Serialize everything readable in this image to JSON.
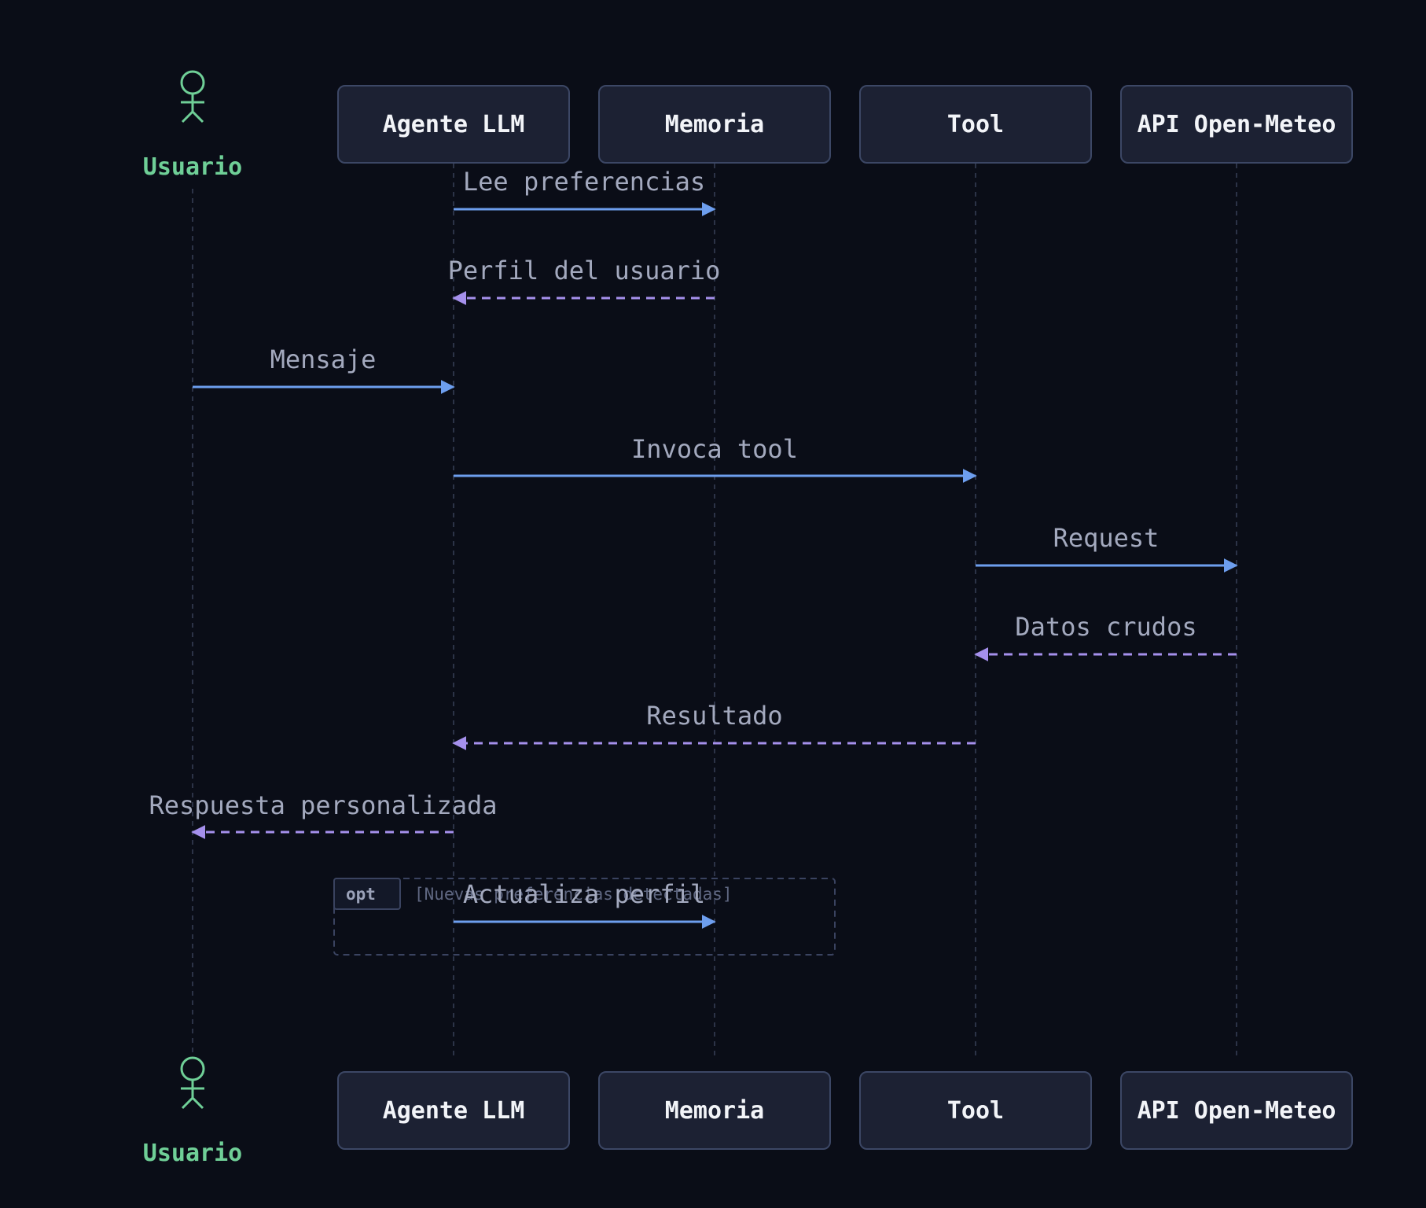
{
  "diagram": {
    "actor": {
      "id": "usuario",
      "label": "Usuario"
    },
    "participants": [
      {
        "id": "agente",
        "label": "Agente LLM"
      },
      {
        "id": "memoria",
        "label": "Memoria"
      },
      {
        "id": "tool",
        "label": "Tool"
      },
      {
        "id": "api",
        "label": "API Open-Meteo"
      }
    ],
    "messages": [
      {
        "from": "agente",
        "to": "memoria",
        "label": "Lee preferencias",
        "style": "solid"
      },
      {
        "from": "memoria",
        "to": "agente",
        "label": "Perfil del usuario",
        "style": "dashed"
      },
      {
        "from": "usuario",
        "to": "agente",
        "label": "Mensaje",
        "style": "solid"
      },
      {
        "from": "agente",
        "to": "tool",
        "label": "Invoca tool",
        "style": "solid"
      },
      {
        "from": "tool",
        "to": "api",
        "label": "Request",
        "style": "solid"
      },
      {
        "from": "api",
        "to": "tool",
        "label": "Datos crudos",
        "style": "dashed"
      },
      {
        "from": "tool",
        "to": "agente",
        "label": "Resultado",
        "style": "dashed"
      },
      {
        "from": "agente",
        "to": "usuario",
        "label": "Respuesta personalizada",
        "style": "dashed"
      },
      {
        "from": "agente",
        "to": "memoria",
        "label": "Actualiza perfil",
        "style": "solid"
      }
    ],
    "opt_block": {
      "tag": "opt",
      "condition": "[Nuevas preferencias detectadas]"
    },
    "colors": {
      "background": "#0a0d17",
      "actor": "#6fcf97",
      "solid_arrow": "#6d9eee",
      "dashed_arrow": "#a590ec",
      "label_text": "#a3a9be"
    }
  }
}
